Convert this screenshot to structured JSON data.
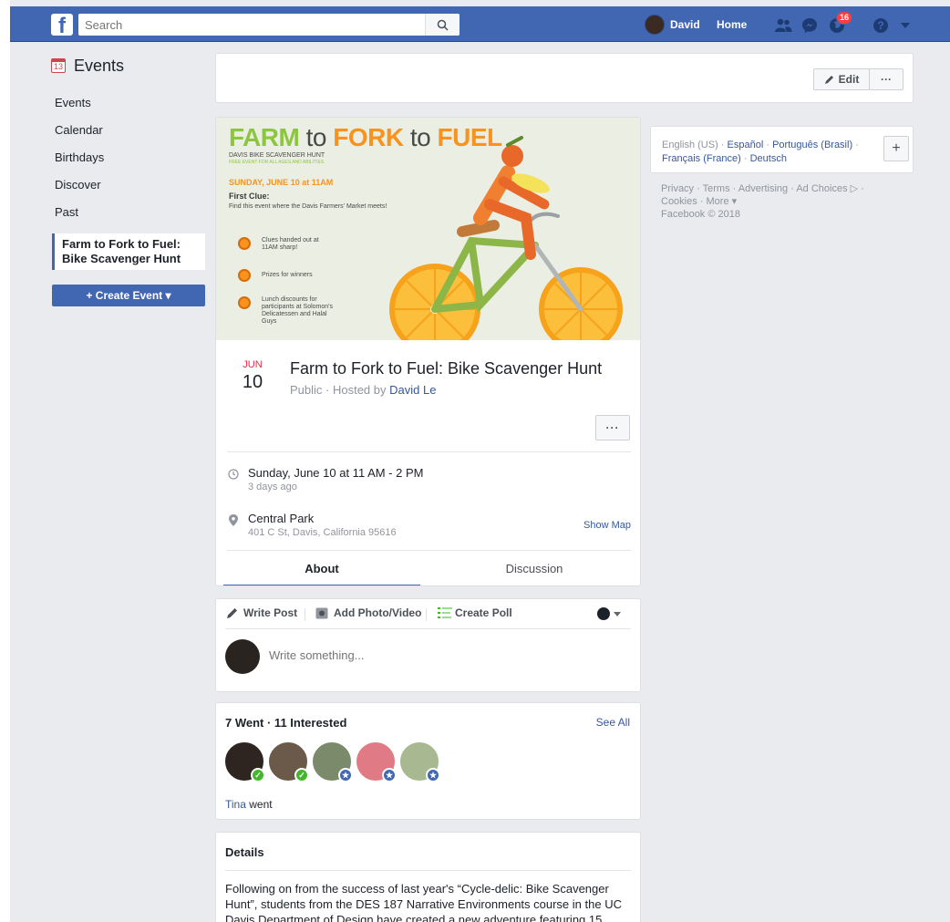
{
  "topbar": {
    "logo": "f",
    "search_placeholder": "Search",
    "user_name": "David",
    "home_label": "Home",
    "notification_count": "16"
  },
  "left_nav": {
    "title": "Events",
    "calendar_icon_number": "13",
    "items": [
      {
        "label": "Events"
      },
      {
        "label": "Calendar"
      },
      {
        "label": "Birthdays"
      },
      {
        "label": "Discover"
      },
      {
        "label": "Past"
      }
    ],
    "selected_event": "Farm to Fork to Fuel: Bike Scavenger Hunt",
    "create_button": "+ Create Event ▾"
  },
  "edit_bar": {
    "edit_label": "Edit",
    "more_label": "···"
  },
  "cover": {
    "title_farm": "FARM",
    "title_to1": " to ",
    "title_fork": "FORK",
    "title_to2": " to ",
    "title_fuel": "FUEL",
    "subtitle": "DAVIS BIKE SCAVENGER HUNT",
    "subtitle2": "FREE EVENT FOR ALL AGES AND ABILITIES",
    "date_line": "SUNDAY, JUNE 10 at 11AM",
    "clue_title": "First Clue:",
    "clue_text": "Find this event where the Davis Farmers' Market meets!",
    "bullets": [
      "Clues handed out at 11AM sharp!",
      "Prizes for winners",
      "Lunch discounts for participants at Solomon's Delicatessen and Halal Guys"
    ]
  },
  "event": {
    "month": "JUN",
    "day": "10",
    "title": "Farm to Fork to Fuel: Bike Scavenger Hunt",
    "privacy": "Public",
    "hosted_by_prefix": " · Hosted by ",
    "host": "David Le",
    "more_label": "···",
    "time_main": "Sunday, June 10 at 11 AM - 2 PM",
    "time_sub": "3 days ago",
    "location_main": "Central Park",
    "location_sub": "401 C St, Davis, California 95616",
    "show_map": "Show Map",
    "tabs": [
      {
        "label": "About"
      },
      {
        "label": "Discussion"
      }
    ]
  },
  "composer": {
    "write_post": "Write Post",
    "add_photo": "Add Photo/Video",
    "create_poll": "Create Poll",
    "placeholder": "Write something..."
  },
  "guests": {
    "title": "7 Went · 11 Interested",
    "see_all": "See All",
    "went_name": "Tina",
    "went_suffix": " went"
  },
  "details": {
    "title": "Details",
    "text": "Following on from the success of last year's “Cycle-delic: Bike Scavenger Hunt”, students from the DES 187 Narrative Environments course in the UC Davis Department of Design have created a new adventure featuring 15"
  },
  "right": {
    "lang_current": "English (US) · ",
    "lang_links": [
      "Español",
      "Português (Brasil)",
      "Français (France)",
      "Deutsch"
    ],
    "footer_line1": "Privacy · Terms · Advertising · Ad Choices ▷ ·",
    "footer_line2": "Cookies · More ▾",
    "footer_line3": "Facebook © 2018"
  },
  "colors": {
    "brand_blue": "#4267b2",
    "page_bg": "#e9ebee",
    "link": "#365899",
    "date_red": "#f02849"
  }
}
